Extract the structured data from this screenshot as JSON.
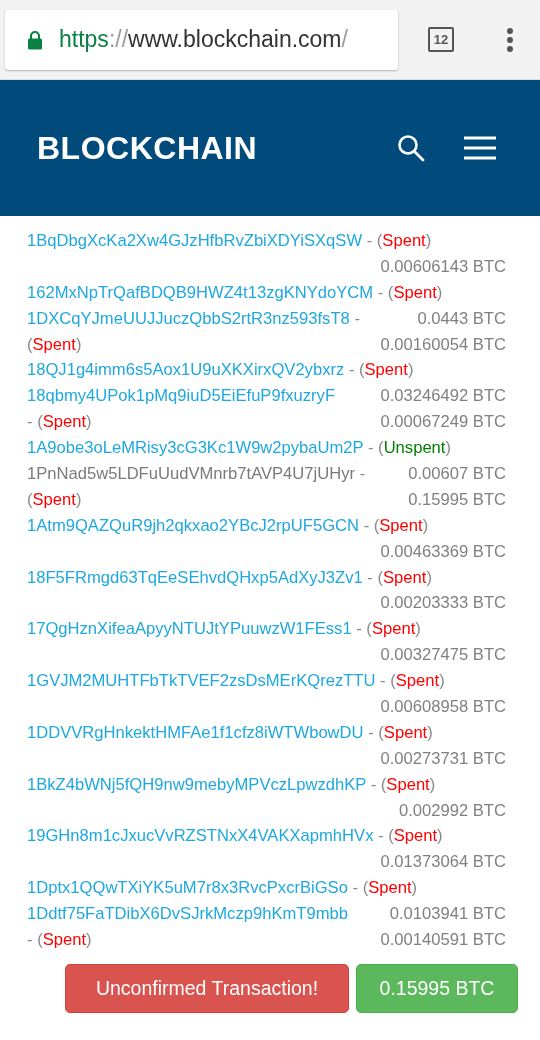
{
  "browser": {
    "url": {
      "scheme": "https",
      "separator": "://",
      "host": "www.blockchain.com",
      "path": "/"
    },
    "tab_count": "12"
  },
  "header": {
    "logo": "BLOCKCHAIN"
  },
  "rows": [
    {
      "address": "1BqDbgXcKa2Xw4GJzHfbRvZbiXDYiSXqSW",
      "linked": true,
      "lead": " - (",
      "status": "Spent",
      "spent": true,
      "tail": ")"
    },
    {
      "amount": "0.00606143 BTC"
    },
    {
      "address": "162MxNpTrQafBDQB9HWZ4t13zgKNYdoYCM",
      "linked": true,
      "lead": " - (",
      "status": "Spent",
      "spent": true,
      "tail": ")"
    },
    {
      "address": "1DXCqYJmeUUJJuczQbbS2rtR3nz593fsT8",
      "linked": true,
      "lead": " -",
      "amount": "0.0443 BTC"
    },
    {
      "lead": "(",
      "status": "Spent",
      "spent": true,
      "tail": ")",
      "amount": "0.00160054 BTC"
    },
    {
      "address": "18QJ1g4imm6s5Aox1U9uXKXirxQV2ybxrz",
      "linked": true,
      "lead": " - (",
      "status": "Spent",
      "spent": true,
      "tail": ")"
    },
    {
      "address": "18qbmy4UPok1pMq9iuD5EiEfuP9fxuzryF",
      "linked": true,
      "amount": "0.03246492 BTC"
    },
    {
      "lead": "- (",
      "status": "Spent",
      "spent": true,
      "tail": ")",
      "amount": "0.00067249 BTC"
    },
    {
      "address": "1A9obe3oLeMRisy3cG3Kc1W9w2pybaUm2P",
      "linked": true,
      "lead": " - (",
      "status": "Unspent",
      "spent": false,
      "tail": ")"
    },
    {
      "address": "1PnNad5w5LDFuUudVMnrb7tAVP4U7jUHyr",
      "linked": false,
      "lead": " -",
      "amount": "0.00607 BTC"
    },
    {
      "lead": "(",
      "status": "Spent",
      "spent": true,
      "tail": ")",
      "amount": "0.15995 BTC"
    },
    {
      "address": "1Atm9QAZQuR9jh2qkxao2YBcJ2rpUF5GCN",
      "linked": true,
      "lead": " - (",
      "status": "Spent",
      "spent": true,
      "tail": ")"
    },
    {
      "amount": "0.00463369 BTC"
    },
    {
      "address": "18F5FRmgd63TqEeSEhvdQHxp5AdXyJ3Zv1",
      "linked": true,
      "lead": " - (",
      "status": "Spent",
      "spent": true,
      "tail": ")"
    },
    {
      "amount": "0.00203333 BTC"
    },
    {
      "address": "17QgHznXifeaApyyNTUJtYPuuwzW1FEss1",
      "linked": true,
      "lead": " - (",
      "status": "Spent",
      "spent": true,
      "tail": ")"
    },
    {
      "amount": "0.00327475 BTC"
    },
    {
      "address": "1GVJM2MUHTFbTkTVEF2zsDsMErKQrezTTU",
      "linked": true,
      "lead": " - (",
      "status": "Spent",
      "spent": true,
      "tail": ")"
    },
    {
      "amount": "0.00608958 BTC"
    },
    {
      "address": "1DDVVRgHnkektHMFAe1f1cfz8iWTWbowDU",
      "linked": true,
      "lead": " - (",
      "status": "Spent",
      "spent": true,
      "tail": ")"
    },
    {
      "amount": "0.00273731 BTC"
    },
    {
      "address": "1BkZ4bWNj5fQH9nw9mebyMPVczLpwzdhKP",
      "linked": true,
      "lead": " - (",
      "status": "Spent",
      "spent": true,
      "tail": ")"
    },
    {
      "amount": "0.002992 BTC"
    },
    {
      "address": "19GHn8m1cJxucVvRZSTNxX4VAKXapmhHVx",
      "linked": true,
      "lead": " - (",
      "status": "Spent",
      "spent": true,
      "tail": ")"
    },
    {
      "amount": "0.01373064 BTC"
    },
    {
      "address": "1Dptx1QQwTXiYK5uM7r8x3RvcPxcrBiGSo",
      "linked": true,
      "lead": " - (",
      "status": "Spent",
      "spent": true,
      "tail": ")"
    },
    {
      "address": "1Ddtf75FaTDibX6DvSJrkMczp9hKmT9mbb",
      "linked": true,
      "amount": "0.0103941 BTC"
    },
    {
      "lead": "- (",
      "status": "Spent",
      "spent": true,
      "tail": ")",
      "amount": "0.00140591 BTC"
    }
  ],
  "buttons": [
    {
      "label": "Unconfirmed Transaction!",
      "kind": "danger"
    },
    {
      "label": "0.15995 BTC",
      "kind": "success"
    }
  ]
}
